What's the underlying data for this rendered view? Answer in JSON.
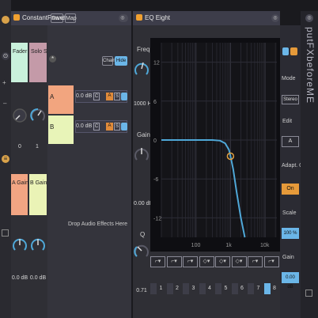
{
  "device1": {
    "title": "ConstantPower",
    "tab_rand": "Rand",
    "tab_map": "Map",
    "fader_label": "Fader",
    "solo_label": "Solo SW",
    "fader_value": "0",
    "solo_value": "1",
    "a_gain_label": "A Gain",
    "b_gain_label": "B Gain",
    "a_gain_value": "0.0 dB",
    "b_gain_value": "0.0 dB",
    "chain_btn": "Chain",
    "hide_btn": "Hide",
    "chains": [
      {
        "name": "A",
        "vol": "0.0 dB",
        "pan": "C",
        "color": "#f2a57f"
      },
      {
        "name": "B",
        "vol": "0.0 dB",
        "pan": "C",
        "color": "#e8f4b8"
      }
    ],
    "drop_text": "Drop Audio Effects Here"
  },
  "device2": {
    "title": "EQ Eight",
    "freq_label": "Freq",
    "freq_value": "1000 Hz",
    "gain_label": "Gain",
    "gain_value": "0.00 dB",
    "q_label": "Q",
    "q_value": "0.71",
    "y_ticks": [
      "12",
      "6",
      "0",
      "-6",
      "-12"
    ],
    "x_ticks": [
      "100",
      "1k",
      "10k"
    ],
    "band_numbers": [
      "1",
      "2",
      "3",
      "4",
      "5",
      "6",
      "7",
      "8"
    ],
    "mode_label": "Mode",
    "mode_value": "Stereo",
    "edit_label": "Edit",
    "edit_value": "A",
    "adapt_label": "Adapt. Q",
    "adapt_value": "On",
    "scale_label": "Scale",
    "scale_value": "100 %",
    "gain_out_label": "Gain",
    "gain_out_value": "0.00 dB",
    "side_text": "putFXbeforeME"
  },
  "chart_data": {
    "type": "line",
    "x_scale": "log",
    "xlim": [
      10,
      22000
    ],
    "ylim": [
      -15,
      15
    ],
    "x_ticks": [
      100,
      1000,
      10000
    ],
    "y_ticks": [
      12,
      6,
      0,
      -6,
      -12
    ],
    "series": [
      {
        "x": [
          10,
          100,
          300,
          500,
          700,
          900,
          1000,
          1200,
          1500,
          2000,
          2600
        ],
        "y": [
          0,
          0,
          0,
          -0.1,
          -0.5,
          -1.5,
          -2.5,
          -4.5,
          -8,
          -12,
          -15
        ]
      }
    ],
    "marker": {
      "x": 1000,
      "y": -2.5
    },
    "colors": {
      "curve": "#4fa8d8",
      "marker": "#e0a040"
    }
  }
}
